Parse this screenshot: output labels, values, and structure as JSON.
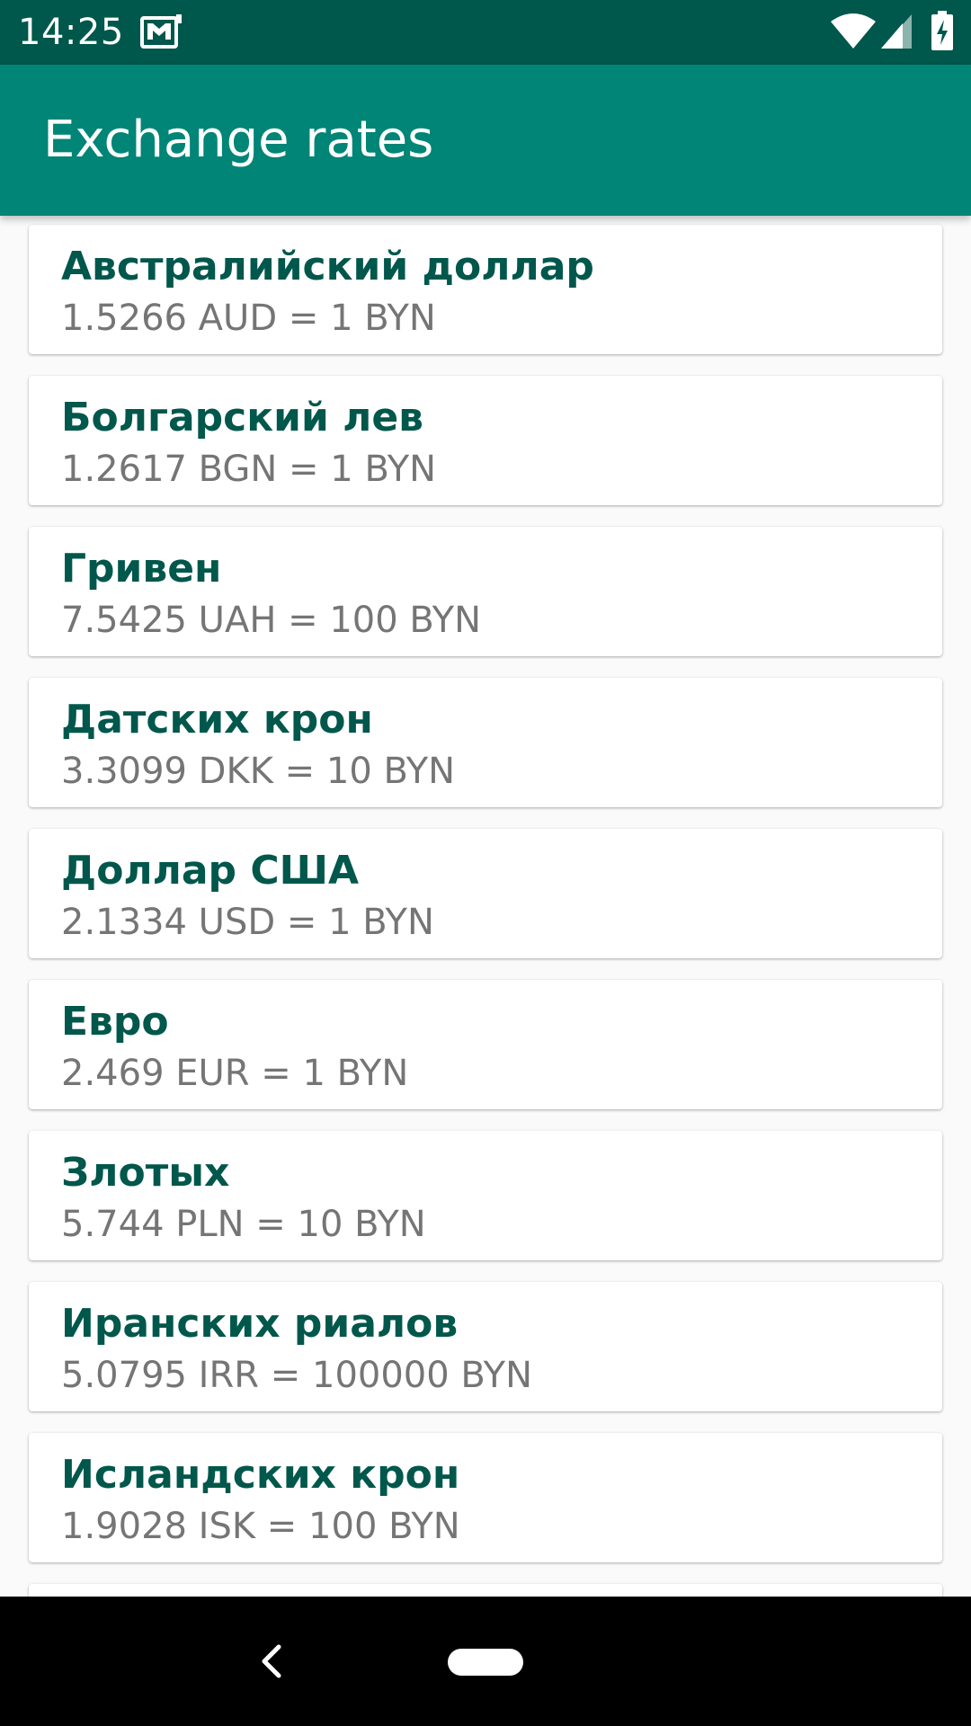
{
  "status_bar": {
    "time": "14:25",
    "icons": [
      "mail-icon",
      "wifi-icon",
      "cell-signal-icon",
      "battery-charging-icon"
    ]
  },
  "app_bar": {
    "title": "Exchange rates"
  },
  "colors": {
    "status_bar": "#00574b",
    "app_bar": "#008577",
    "accent_text": "#00574b",
    "secondary_text": "#757575",
    "nav_bar": "#000000"
  },
  "rates": [
    {
      "name": "Австралийский доллар",
      "rate": "1.5266 AUD = 1 BYN"
    },
    {
      "name": "Болгарский лев",
      "rate": "1.2617 BGN = 1 BYN"
    },
    {
      "name": "Гривен",
      "rate": "7.5425 UAH = 100 BYN"
    },
    {
      "name": "Датских крон",
      "rate": "3.3099 DKK = 10 BYN"
    },
    {
      "name": "Доллар США",
      "rate": "2.1334 USD = 1 BYN"
    },
    {
      "name": "Евро",
      "rate": "2.469 EUR = 1 BYN"
    },
    {
      "name": "Злотых",
      "rate": "5.744 PLN = 10 BYN"
    },
    {
      "name": "Иранских риалов",
      "rate": "5.0795 IRR = 100000 BYN"
    },
    {
      "name": "Исландских крон",
      "rate": "1.9028 ISK = 100 BYN"
    }
  ],
  "nav_bar": {
    "icons": [
      "back-icon",
      "home-pill-icon"
    ]
  }
}
